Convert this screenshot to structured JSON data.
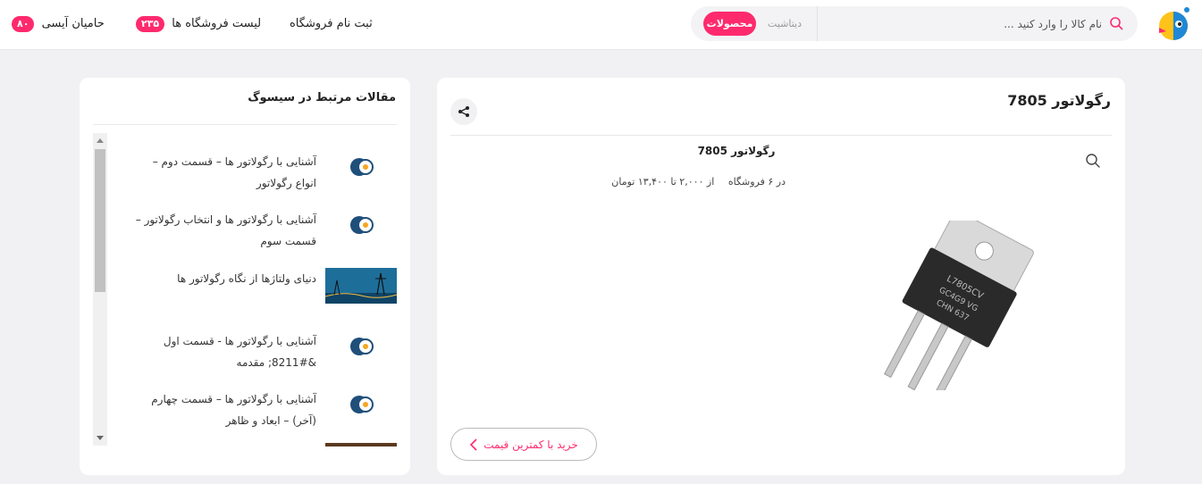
{
  "header": {
    "search": {
      "placeholder": "نام کالا را وارد کنید ...",
      "tab_datasheet": "دیتاشیت",
      "tab_products": "محصولات"
    },
    "nav": {
      "register_store": "ثبت نام فروشگاه",
      "store_list": {
        "label": "لیست فروشگاه ها",
        "count": "۲۳۵"
      },
      "sponsors": {
        "label": "حامیان آیسی",
        "count": "۸۰"
      }
    }
  },
  "product": {
    "title": "رگولاتور 7805",
    "item_title": "رگولاتور 7805",
    "store_count": "در ۶ فروشگاه",
    "price_range": "از ۲,۰۰۰ تا ۱۳,۴۰۰ تومان",
    "buy_label": "خرید با کمترین قیمت"
  },
  "articles": {
    "title": "مقالات مرتبط در سیسوگ",
    "items": [
      {
        "text": "آشنایی با رگولاتور ها – قسمت دوم – انواع رگولاتور",
        "thumb": "sisoog-logo"
      },
      {
        "text": "آشنایی با رگولاتور ها و انتخاب رگولاتور – قسمت سوم",
        "thumb": "sisoog-logo"
      },
      {
        "text": "دنیای ولتاژها از نگاه رگولاتور ها",
        "thumb": "power-lines-photo"
      },
      {
        "text": "آشنایی با رگولاتور ها - قسمت اول &#8211; مقدمه",
        "thumb": "sisoog-logo"
      },
      {
        "text": "آشنایی با رگولاتور ها – قسمت چهارم (آخر) – ابعاد و ظاهر",
        "thumb": "sisoog-logo"
      }
    ]
  },
  "colors": {
    "accent": "#ff2a6d",
    "background": "#f1f1f3",
    "card": "#ffffff"
  }
}
